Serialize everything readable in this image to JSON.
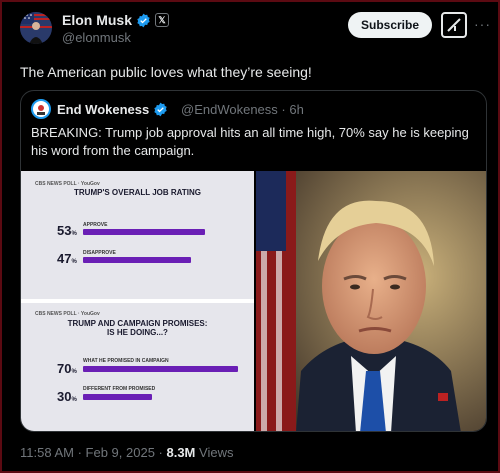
{
  "author": {
    "name": "Elon Musk",
    "handle": "@elonmusk"
  },
  "actions": {
    "subscribe_label": "Subscribe"
  },
  "tweet": {
    "text": "The American public loves what they’re seeing!"
  },
  "quoted": {
    "name": "End Wokeness",
    "handle": "@EndWokeness",
    "time": "6h",
    "text": "BREAKING: Trump job approval hits an all time high, 70% say he is keeping his word from the campaign."
  },
  "poll1": {
    "source": "CBS NEWS POLL · YouGov",
    "title": "TRUMP'S OVERALL JOB RATING",
    "items": [
      {
        "pct": "53",
        "label": "APPROVE",
        "value": 53
      },
      {
        "pct": "47",
        "label": "DISAPPROVE",
        "value": 47
      }
    ]
  },
  "poll2": {
    "source": "CBS NEWS POLL · YouGov",
    "title_line1": "TRUMP AND CAMPAIGN PROMISES:",
    "title_line2": "IS HE DOING...?",
    "items": [
      {
        "pct": "70",
        "label": "WHAT HE PROMISED IN CAMPAIGN",
        "value": 70
      },
      {
        "pct": "30",
        "label": "DIFFERENT FROM PROMISED",
        "value": 30
      }
    ]
  },
  "footer": {
    "time": "11:58 AM",
    "date": "Feb 9, 2025",
    "views_count": "8.3M",
    "views_label": "Views"
  },
  "colors": {
    "bar": "#6a1fb5",
    "verified": "#1d9bf0",
    "frame": "#5c0a12"
  }
}
